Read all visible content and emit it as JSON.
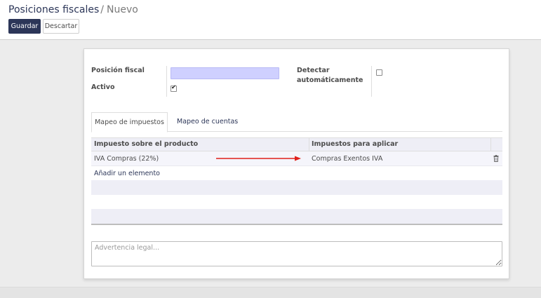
{
  "breadcrumb": {
    "parent": "Posiciones fiscales",
    "separator": "/",
    "current": "Nuevo"
  },
  "toolbar": {
    "save_label": "Guardar",
    "discard_label": "Descartar"
  },
  "form": {
    "name_label": "Posición fiscal",
    "name_value": "",
    "active_label": "Activo",
    "active_checked": true,
    "auto_detect_label_line1": "Detectar",
    "auto_detect_label_line2": "automáticamente",
    "auto_detect_checked": false
  },
  "tabs": [
    {
      "label": "Mapeo de impuestos",
      "active": true
    },
    {
      "label": "Mapeo de cuentas",
      "active": false
    }
  ],
  "tax_table": {
    "columns": [
      "Impuesto sobre el producto",
      "Impuestos para aplicar"
    ],
    "rows": [
      {
        "source": "IVA Compras (22%)",
        "destination": "Compras Exentos IVA"
      }
    ],
    "add_line": "Añadir un elemento",
    "annotation_color": "#e0201b"
  },
  "legal_note": {
    "placeholder": "Advertencia legal...",
    "value": ""
  },
  "colors": {
    "primary": "#2c3658",
    "required_field": "#cfd0ff",
    "header_bg": "#eeeef6"
  }
}
